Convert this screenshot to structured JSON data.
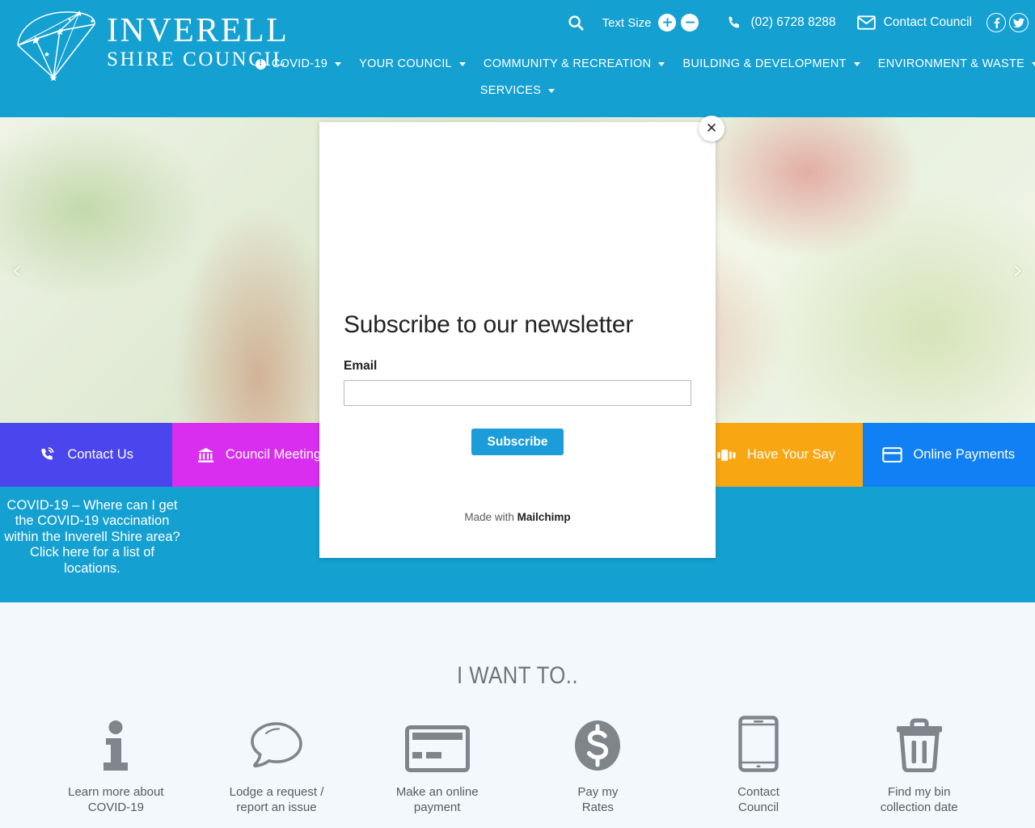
{
  "site": {
    "logo_line1": "INVERELL",
    "logo_line2": "SHIRE COUNCIL",
    "brand_blue": "#15a0d2"
  },
  "header": {
    "search_icon": "search-icon",
    "text_size_label": "Text Size",
    "text_size_increase": "+",
    "text_size_decrease": "−",
    "phone_icon": "phone-icon",
    "phone": "(02) 6728 8288",
    "mail_icon": "mail-icon",
    "contact_label": "Contact Council",
    "facebook_icon": "facebook-icon",
    "twitter_icon": "twitter-icon"
  },
  "nav": {
    "row1": [
      {
        "label": "COVID-19",
        "has_caret": true,
        "has_alert_dot": true
      },
      {
        "label": "YOUR COUNCIL",
        "has_caret": true,
        "has_alert_dot": false
      },
      {
        "label": "COMMUNITY & RECREATION",
        "has_caret": true,
        "has_alert_dot": false
      },
      {
        "label": "BUILDING & DEVELOPMENT",
        "has_caret": true,
        "has_alert_dot": false
      },
      {
        "label": "ENVIRONMENT & WASTE",
        "has_caret": true,
        "has_alert_dot": false
      }
    ],
    "row2": [
      {
        "label": "SERVICES",
        "has_caret": true,
        "has_alert_dot": false
      }
    ]
  },
  "hero": {
    "prev_arrow": "‹",
    "next_arrow": "›"
  },
  "quick_links": [
    {
      "label": "Contact Us",
      "color": "#4b45ee",
      "icon": "phone-volume-icon"
    },
    {
      "label": "Council Meeting",
      "color": "#d92ef0",
      "icon": "bank-icon"
    },
    {
      "label": "",
      "color": "#ffffff",
      "icon": ""
    },
    {
      "label": "",
      "color": "#ffffff",
      "icon": ""
    },
    {
      "label": "Have Your Say",
      "color": "#f8a712",
      "icon": "megaphone-icon"
    },
    {
      "label": "Online Payments",
      "color": "#1180f5",
      "icon": "credit-card-icon"
    }
  ],
  "alert": {
    "text": "COVID-19 – Where can I get the COVID-19 vaccination within the Inverell Shire area? Click here for a list of locations."
  },
  "i_want_to": {
    "title": "I WANT TO..",
    "items": [
      {
        "label": "Learn more about\nCOVID-19",
        "icon": "info-icon"
      },
      {
        "label": "Lodge a request /\nreport an issue",
        "icon": "speech-bubble-icon"
      },
      {
        "label": "Make an online\npayment",
        "icon": "credit-card-icon"
      },
      {
        "label": "Pay my\nRates",
        "icon": "dollar-coin-icon"
      },
      {
        "label": "Contact\nCouncil",
        "icon": "mobile-phone-icon"
      },
      {
        "label": "Find my bin\ncollection date",
        "icon": "trash-bin-icon"
      }
    ]
  },
  "newsletter_modal": {
    "close_label": "✕",
    "title": "Subscribe to our newsletter",
    "email_label": "Email",
    "email_value": "",
    "email_placeholder": "",
    "subscribe_label": "Subscribe",
    "footer_prefix": "Made with ",
    "footer_brand": "Mailchimp"
  }
}
